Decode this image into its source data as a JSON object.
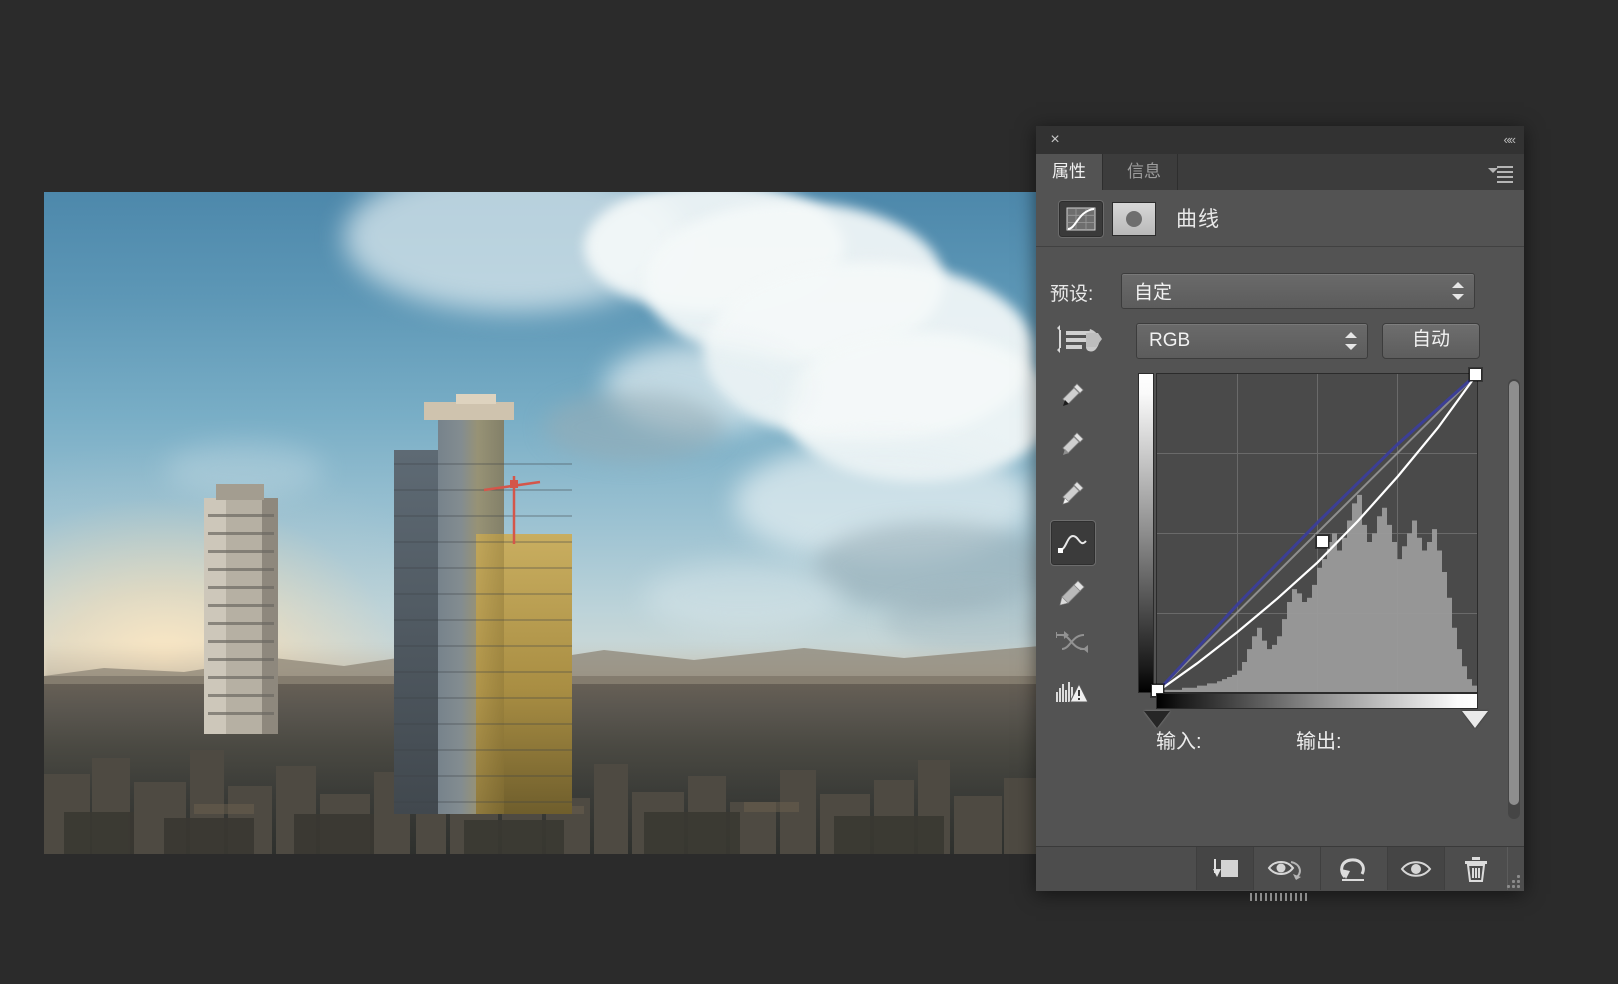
{
  "panel": {
    "close_label": "×",
    "collapse_label": "«",
    "tabs": [
      {
        "label": "属性",
        "active": true
      },
      {
        "label": "信息",
        "active": false
      }
    ],
    "adjustment_title": "曲线",
    "adjustment_icon": "curves-icon",
    "mask_thumbnail_icon": "layer-mask-thumbnail",
    "menu_icon": "panel-menu-icon"
  },
  "preset": {
    "label": "预设:",
    "value": "自定"
  },
  "channel": {
    "value": "RGB",
    "on_image_adjust_icon": "on-image-adjustment-icon",
    "auto_button": "自动"
  },
  "tools": [
    {
      "name": "black-point-eyedropper-icon",
      "active": false,
      "dim": false
    },
    {
      "name": "gray-point-eyedropper-icon",
      "active": false,
      "dim": false
    },
    {
      "name": "white-point-eyedropper-icon",
      "active": false,
      "dim": false
    },
    {
      "name": "edit-points-curve-icon",
      "active": true,
      "dim": false
    },
    {
      "name": "pencil-draw-curve-icon",
      "active": false,
      "dim": false
    },
    {
      "name": "smooth-curve-icon",
      "active": false,
      "dim": true
    },
    {
      "name": "histogram-clipping-warning-icon",
      "active": false,
      "dim": false
    }
  ],
  "io": {
    "input_label": "输入:",
    "input_value": "",
    "output_label": "输出:",
    "output_value": ""
  },
  "footer": {
    "buttons": [
      {
        "name": "clip-to-layer-button",
        "icon": "clip-to-layer-icon"
      },
      {
        "name": "toggle-previous-state-button",
        "icon": "eye-with-arrow-icon"
      },
      {
        "name": "reset-adjustment-button",
        "icon": "reset-arrow-icon"
      },
      {
        "name": "toggle-layer-visibility-button",
        "icon": "eye-icon"
      },
      {
        "name": "delete-adjustment-layer-button",
        "icon": "trash-icon"
      }
    ],
    "resize_grip": "resize-grip-icon"
  },
  "colors": {
    "panel_bg": "#535353",
    "panel_dark": "#3c3c3c",
    "graph_bg": "#4a4a4a",
    "grid_line": "#6a6a6a",
    "curve_white": "#ffffff",
    "curve_blue": "#3c3f96",
    "baseline": "#9a9a9a",
    "histogram": "#9c9c9c",
    "text": "#ededed",
    "app_bg": "#2b2b2b"
  },
  "chart_data": {
    "type": "line",
    "title": "RGB Tone Curve",
    "xlabel": "Input",
    "ylabel": "Output",
    "xlim": [
      0,
      255
    ],
    "ylim": [
      0,
      255
    ],
    "grid": true,
    "legend": "none",
    "series": [
      {
        "name": "baseline-identity",
        "color": "#9a9a9a",
        "x": [
          0,
          255
        ],
        "y": [
          0,
          255
        ]
      },
      {
        "name": "blue-channel-curve",
        "color": "#3c3f96",
        "x": [
          0,
          64,
          128,
          191,
          255
        ],
        "y": [
          0,
          70,
          136,
          198,
          255
        ]
      },
      {
        "name": "rgb-composite-curve",
        "color": "#ffffff",
        "control_points": [
          {
            "input": 0,
            "output": 0
          },
          {
            "input": 128,
            "output": 104
          },
          {
            "input": 255,
            "output": 255
          }
        ],
        "x": [
          0,
          32,
          64,
          96,
          128,
          160,
          192,
          224,
          255
        ],
        "y": [
          0,
          23,
          48,
          75,
          104,
          137,
          173,
          212,
          255
        ]
      }
    ],
    "histogram": {
      "name": "image-histogram",
      "color": "#9c9c9c",
      "bin_count": 64,
      "values": [
        1,
        1,
        1,
        1,
        1,
        2,
        2,
        2,
        3,
        3,
        4,
        4,
        5,
        6,
        7,
        8,
        10,
        14,
        20,
        26,
        30,
        24,
        20,
        22,
        26,
        34,
        42,
        48,
        46,
        42,
        44,
        50,
        58,
        62,
        70,
        74,
        66,
        72,
        80,
        88,
        92,
        78,
        70,
        74,
        82,
        86,
        78,
        70,
        62,
        68,
        74,
        80,
        72,
        66,
        70,
        76,
        66,
        56,
        44,
        30,
        20,
        12,
        6,
        3
      ]
    },
    "sliders": {
      "black_point": 0,
      "white_point": 255
    }
  }
}
